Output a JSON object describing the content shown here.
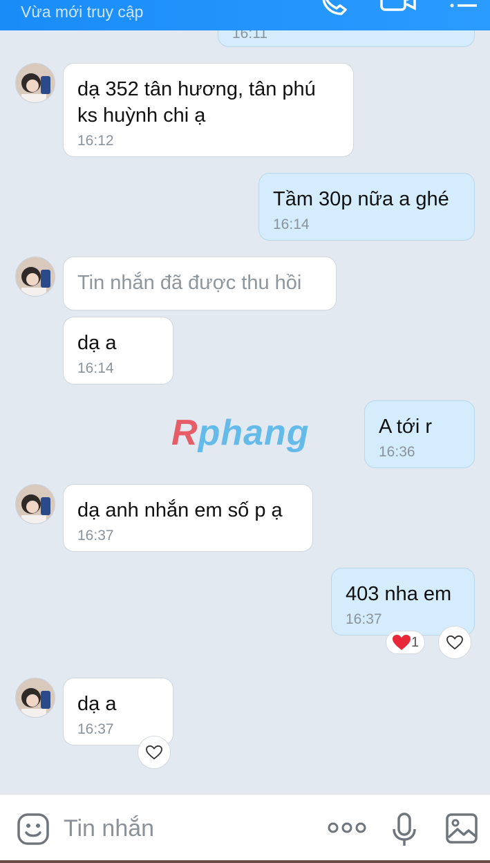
{
  "header": {
    "status": "Vừa mới truy cập"
  },
  "messages": [
    {
      "id": "m0",
      "dir": "out",
      "time": "16:11"
    },
    {
      "id": "m1",
      "dir": "in",
      "text": "dạ 352 tân hương, tân phú",
      "text2": "ks huỳnh chi ạ",
      "time": "16:12"
    },
    {
      "id": "m2",
      "dir": "out",
      "text": "Tầm 30p nữa a ghé",
      "time": "16:14"
    },
    {
      "id": "m3",
      "dir": "in",
      "text": "Tin nhắn đã được thu hồi",
      "recalled": true
    },
    {
      "id": "m4",
      "dir": "in",
      "text": "dạ a",
      "time": "16:14"
    },
    {
      "id": "m5",
      "dir": "out",
      "text": "A tới r",
      "time": "16:36"
    },
    {
      "id": "m6",
      "dir": "in",
      "text": "dạ anh nhắn em số p ạ",
      "time": "16:37"
    },
    {
      "id": "m7",
      "dir": "out",
      "text": "403 nha em",
      "time": "16:37",
      "reaction_count": "1"
    },
    {
      "id": "m8",
      "dir": "in",
      "text": "dạ a",
      "time": "16:37"
    }
  ],
  "watermark": {
    "first": "R",
    "rest": "phang"
  },
  "composer": {
    "placeholder": "Tin nhắn"
  },
  "icons": {
    "header": [
      "phone-icon",
      "video-call-icon",
      "menu-icon"
    ],
    "composer": [
      "emoji-icon",
      "more-icon",
      "microphone-icon",
      "image-icon"
    ],
    "reactions": [
      "heart-icon"
    ]
  },
  "colors": {
    "header": "#1a8cf7",
    "background": "#e2e9f1",
    "incoming_bubble": "#ffffff",
    "outgoing_bubble": "#d4ecfb"
  }
}
